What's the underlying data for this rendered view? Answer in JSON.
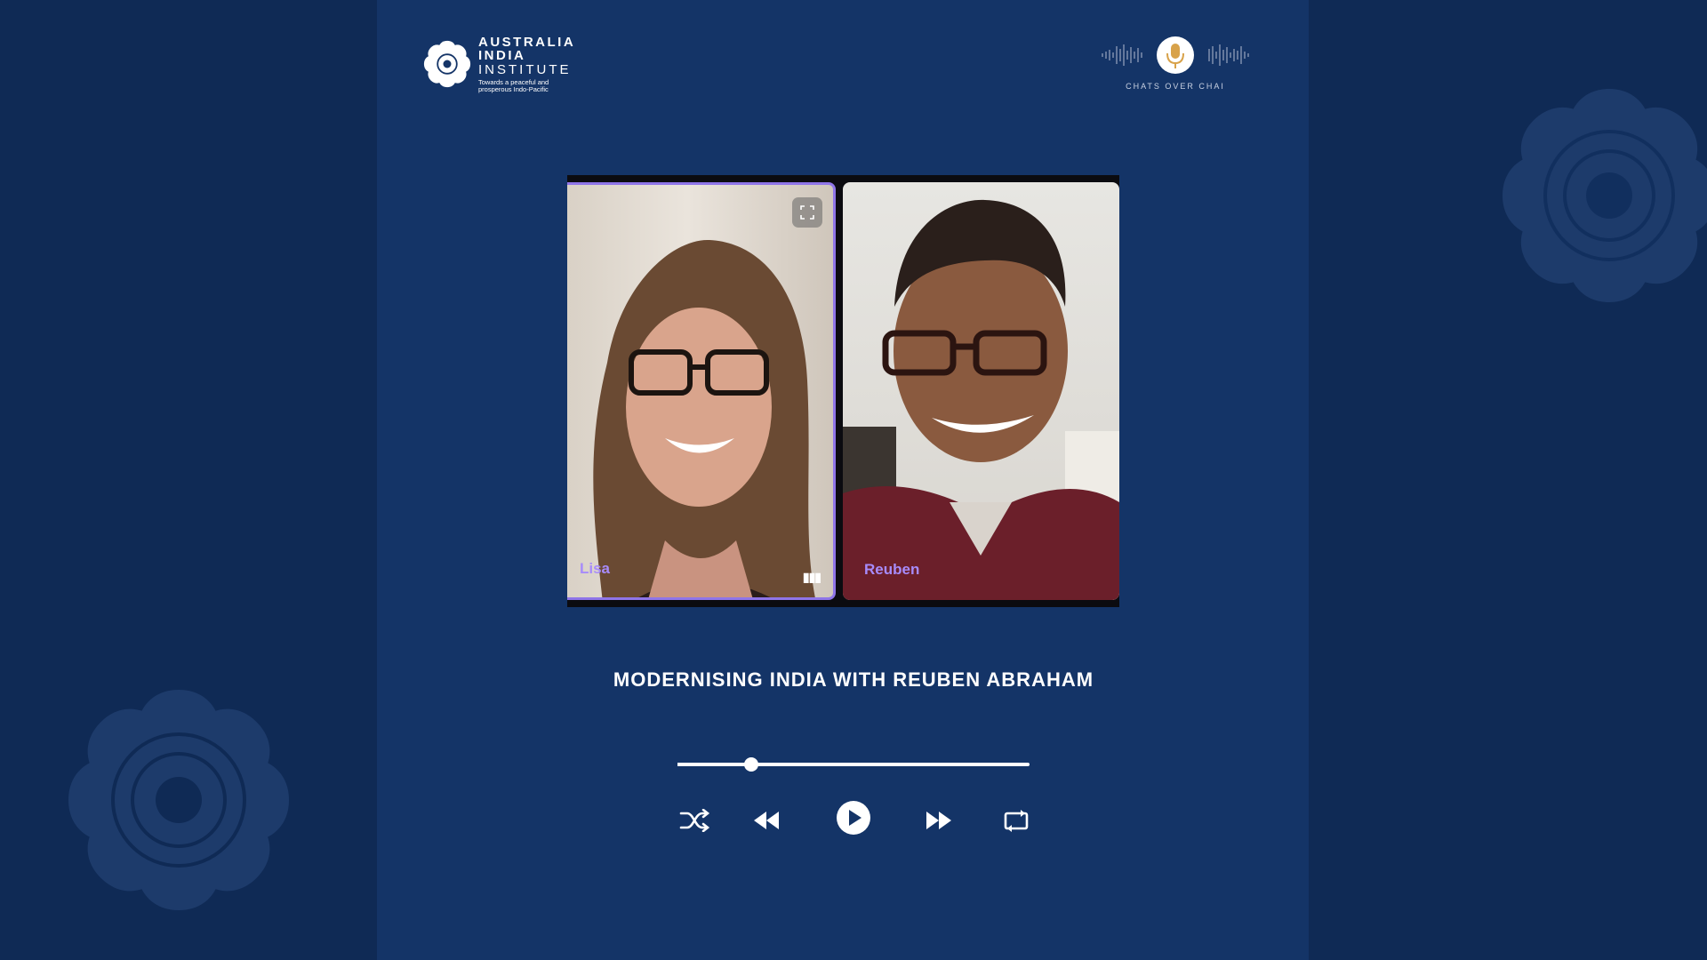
{
  "brand": {
    "line1": "AUSTRALIA",
    "line2": "INDIA",
    "line3": "INSTITUTE",
    "tagline": "Towards a peaceful and prosperous Indo-Pacific"
  },
  "podcast": {
    "name": "CHATS OVER CHAI",
    "icon": "microphone-icon"
  },
  "participants": [
    {
      "name": "Lisa",
      "active": true
    },
    {
      "name": "Reuben",
      "active": false
    }
  ],
  "episode": {
    "title": "MODERNISING INDIA WITH REUBEN ABRAHAM"
  },
  "player": {
    "progress": 0.21,
    "state": "paused",
    "controls": [
      "shuffle-icon",
      "rewind-icon",
      "play-icon",
      "fast-forward-icon",
      "repeat-icon"
    ]
  },
  "colors": {
    "background": "#0f2a55",
    "panel": "#143467",
    "active_speaker": "#8f75e8",
    "name_label": "#a78bfa",
    "podcast_accent": "#d8a24a"
  }
}
